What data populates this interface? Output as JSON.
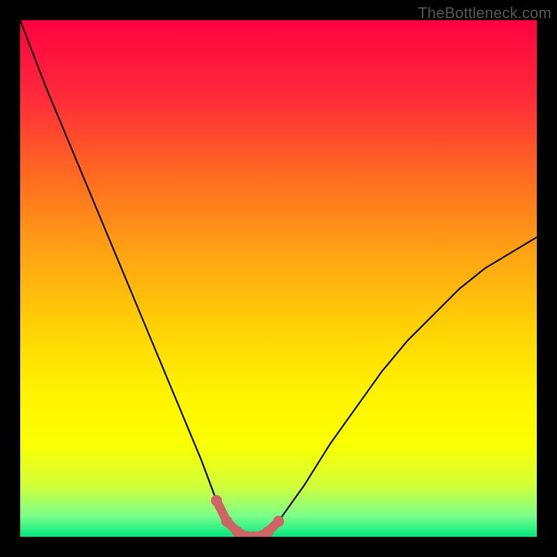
{
  "watermark": "TheBottleneck.com",
  "chart_data": {
    "type": "line",
    "title": "",
    "xlabel": "",
    "ylabel": "",
    "xlim": [
      0,
      100
    ],
    "ylim": [
      0,
      100
    ],
    "series": [
      {
        "name": "bottleneck-curve",
        "x": [
          0,
          5,
          10,
          15,
          20,
          25,
          30,
          35,
          38,
          40,
          42,
          44,
          45,
          46,
          48,
          50,
          55,
          60,
          65,
          70,
          75,
          80,
          85,
          90,
          95,
          100
        ],
        "y": [
          100,
          87,
          75,
          63,
          51,
          39,
          27,
          15,
          7,
          3,
          1,
          0,
          0,
          0,
          1,
          3,
          10,
          18,
          25,
          32,
          38,
          43,
          48,
          52,
          55,
          58
        ]
      },
      {
        "name": "optimal-zone",
        "x": [
          38,
          40,
          42,
          44,
          45,
          46,
          48,
          50
        ],
        "y": [
          7,
          3,
          1,
          0,
          0,
          0,
          1,
          3
        ]
      }
    ],
    "gradient_stops": [
      {
        "offset": 0.0,
        "color": "#ff0240"
      },
      {
        "offset": 0.15,
        "color": "#ff2b3a"
      },
      {
        "offset": 0.3,
        "color": "#ff6a20"
      },
      {
        "offset": 0.45,
        "color": "#ffa313"
      },
      {
        "offset": 0.6,
        "color": "#ffd305"
      },
      {
        "offset": 0.72,
        "color": "#fff300"
      },
      {
        "offset": 0.82,
        "color": "#fbff00"
      },
      {
        "offset": 0.9,
        "color": "#d3ff37"
      },
      {
        "offset": 0.96,
        "color": "#7aff8b"
      },
      {
        "offset": 1.0,
        "color": "#00e880"
      }
    ],
    "colors": {
      "curve": "#000000",
      "optimal_marker": "#cf6464"
    }
  }
}
